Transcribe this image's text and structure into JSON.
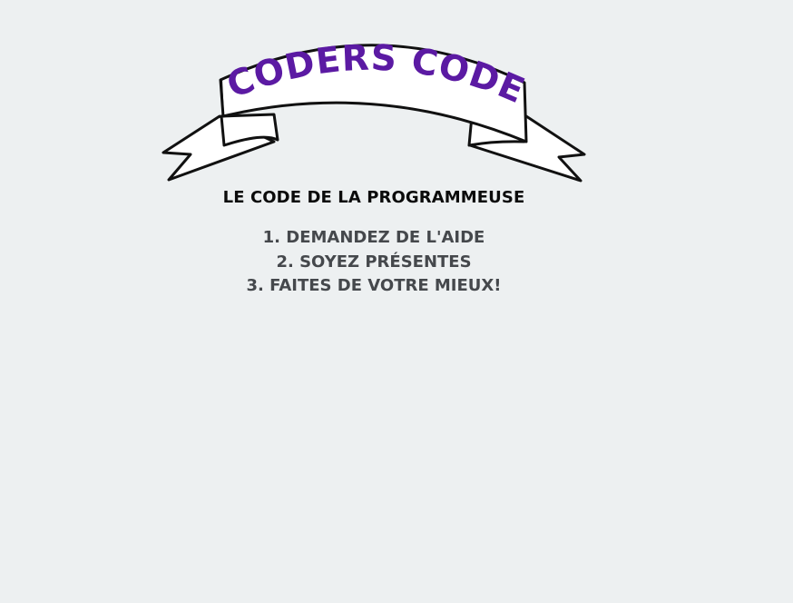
{
  "banner": {
    "text": "‹CODERS CODE›",
    "text_color": "#5b1aa3",
    "logo_icon": "ribbon-banner-icon"
  },
  "code": {
    "title": "LE CODE DE LA PROGRAMMEUSE",
    "rules": [
      "1. DEMANDEZ DE L'AIDE",
      "2. SOYEZ PRÉSENTES",
      "3. FAITES DE VOTRE MIEUX!"
    ]
  },
  "colors": {
    "background": "#edf0f1",
    "title_text": "#0b0b0b",
    "rule_text": "#45484c"
  }
}
